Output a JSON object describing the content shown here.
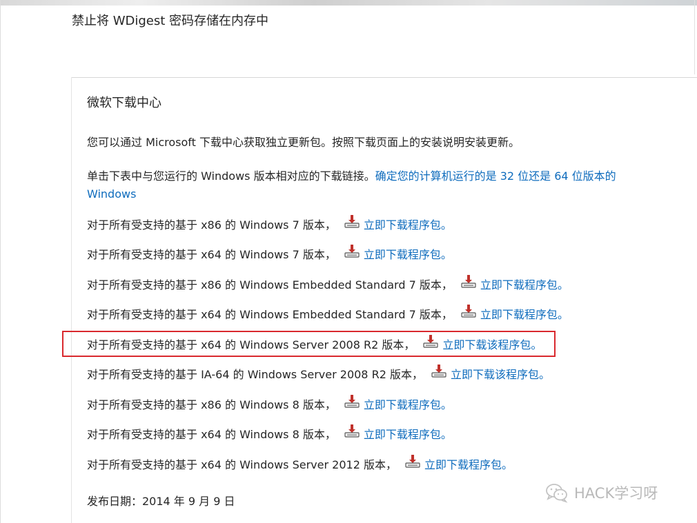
{
  "page": {
    "title": "禁止将 WDigest 密码存储在内存中"
  },
  "section": {
    "heading": "微软下载中心",
    "intro": "您可以通过 Microsoft 下载中心获取独立更新包。按照下载页面上的安装说明安装更新。",
    "instruction_text": "单击下表中与您运行的 Windows 版本相对应的下载链接。",
    "instruction_link": "确定您的计算机运行的是 32 位还是 64 位版本的 Windows"
  },
  "downloads": [
    {
      "text": "对于所有受支持的基于 x86 的 Windows 7 版本，",
      "icon": "download-icon",
      "link": "立即下载程序包。"
    },
    {
      "text": "对于所有受支持的基于 x64 的 Windows 7 版本，",
      "icon": "download-icon",
      "link": "立即下载程序包。"
    },
    {
      "text": "对于所有受支持的基于 x86 的 Windows Embedded Standard 7 版本，",
      "icon": "download-icon",
      "link": "立即下载程序包。"
    },
    {
      "text": "对于所有受支持的基于 x64 的 Windows Embedded Standard 7 版本，",
      "icon": "download-icon",
      "link": "立即下载程序包。"
    },
    {
      "text": "对于所有受支持的基于 x64 的 Windows Server 2008 R2 版本，",
      "icon": "download-icon",
      "link": "立即下载该程序包。"
    },
    {
      "text": "对于所有受支持的基于 IA-64 的 Windows Server 2008 R2 版本，",
      "icon": "download-icon",
      "link": "立即下载该程序包。"
    },
    {
      "text": "对于所有受支持的基于 x86 的 Windows 8 版本，",
      "icon": "download-icon",
      "link": "立即下载程序包。"
    },
    {
      "text": "对于所有受支持的基于 x64 的 Windows 8 版本，",
      "icon": "download-icon",
      "link": "立即下载程序包。"
    },
    {
      "text": "对于所有受支持的基于 x64 的 Windows Server 2012 版本，",
      "icon": "download-icon",
      "link": "立即下载程序包。"
    }
  ],
  "publish_date": "发布日期：2014 年 9 月 9 日",
  "watermark": {
    "icon": "wechat-icon",
    "text": "HACK学习呀"
  },
  "colors": {
    "link": "#0f6cbd",
    "highlight_border": "#d9282d",
    "text": "#262626"
  }
}
